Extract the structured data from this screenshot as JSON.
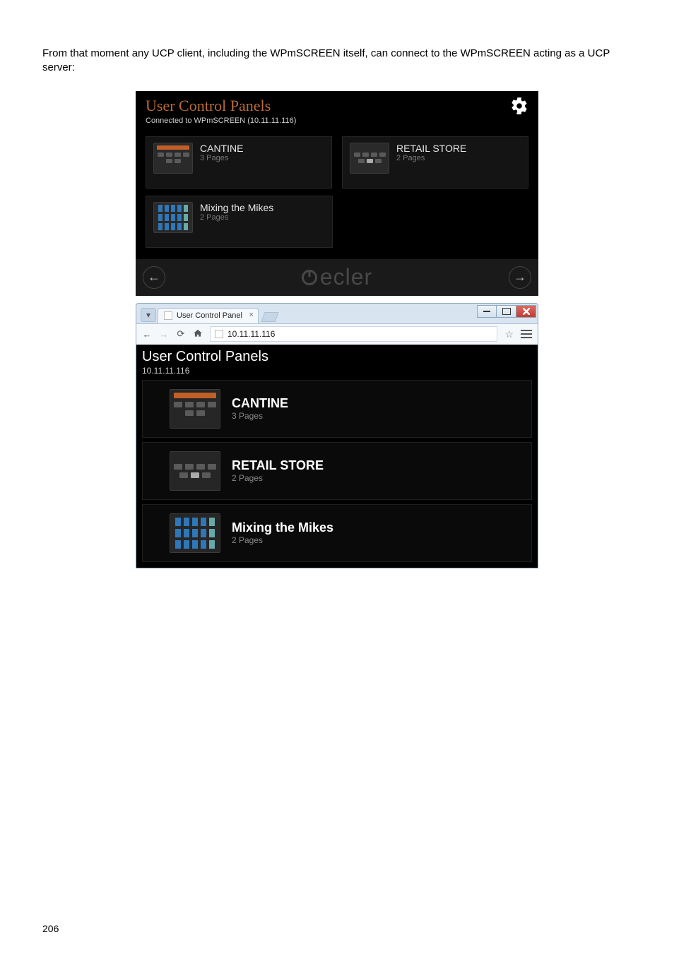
{
  "intro_text": "From that moment any UCP client, including the WPmSCREEN itself, can connect to the WPmSCREEN acting as a UCP server:",
  "page_number": "206",
  "fig1": {
    "title": "User Control Panels",
    "subtitle": "Connected to WPmSCREEN (10.11.11.116)",
    "brand": "ecler",
    "panels": [
      {
        "name": "CANTINE",
        "pages": "3 Pages"
      },
      {
        "name": "RETAIL STORE",
        "pages": "2 Pages"
      },
      {
        "name": "Mixing the Mikes",
        "pages": "2 Pages"
      }
    ]
  },
  "fig2": {
    "tab_label": "User Control Panel",
    "address": "10.11.11.116",
    "page_title": "User Control Panels",
    "page_sub": "10.11.11.116",
    "rows": [
      {
        "name": "CANTINE",
        "pages": "3 Pages"
      },
      {
        "name": "RETAIL STORE",
        "pages": "2 Pages"
      },
      {
        "name": "Mixing the Mikes",
        "pages": "2 Pages"
      }
    ]
  }
}
